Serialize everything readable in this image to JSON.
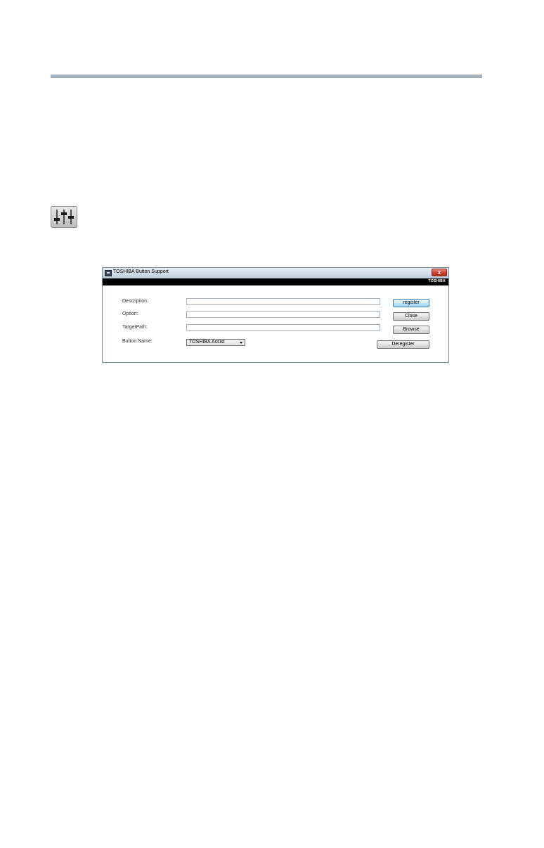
{
  "dialog": {
    "title": "TOSHIBA Button Support",
    "close_glyph": "x",
    "brand": "TOSHIBA",
    "labels": {
      "description": "Description:",
      "option": "Option:",
      "target_path": "TargetPath:",
      "button_name": "Button Name:"
    },
    "fields": {
      "description_value": "",
      "option_value": "",
      "target_path_value": ""
    },
    "button_name_selected": "TOSHIBA Assist",
    "buttons": {
      "register": "register",
      "close": "Close",
      "browse": "Browse",
      "deregister": "Deregister"
    }
  },
  "icons": {
    "equalizer": "equalizer-sliders-icon",
    "app": "toshiba-app-icon",
    "close": "close-icon",
    "dropdown": "chevron-down-icon"
  },
  "colors": {
    "rule": "#a6b3bd",
    "brand_bar": "#000000",
    "close_button": "#c9402c",
    "default_button_border": "#3c7fb1"
  }
}
